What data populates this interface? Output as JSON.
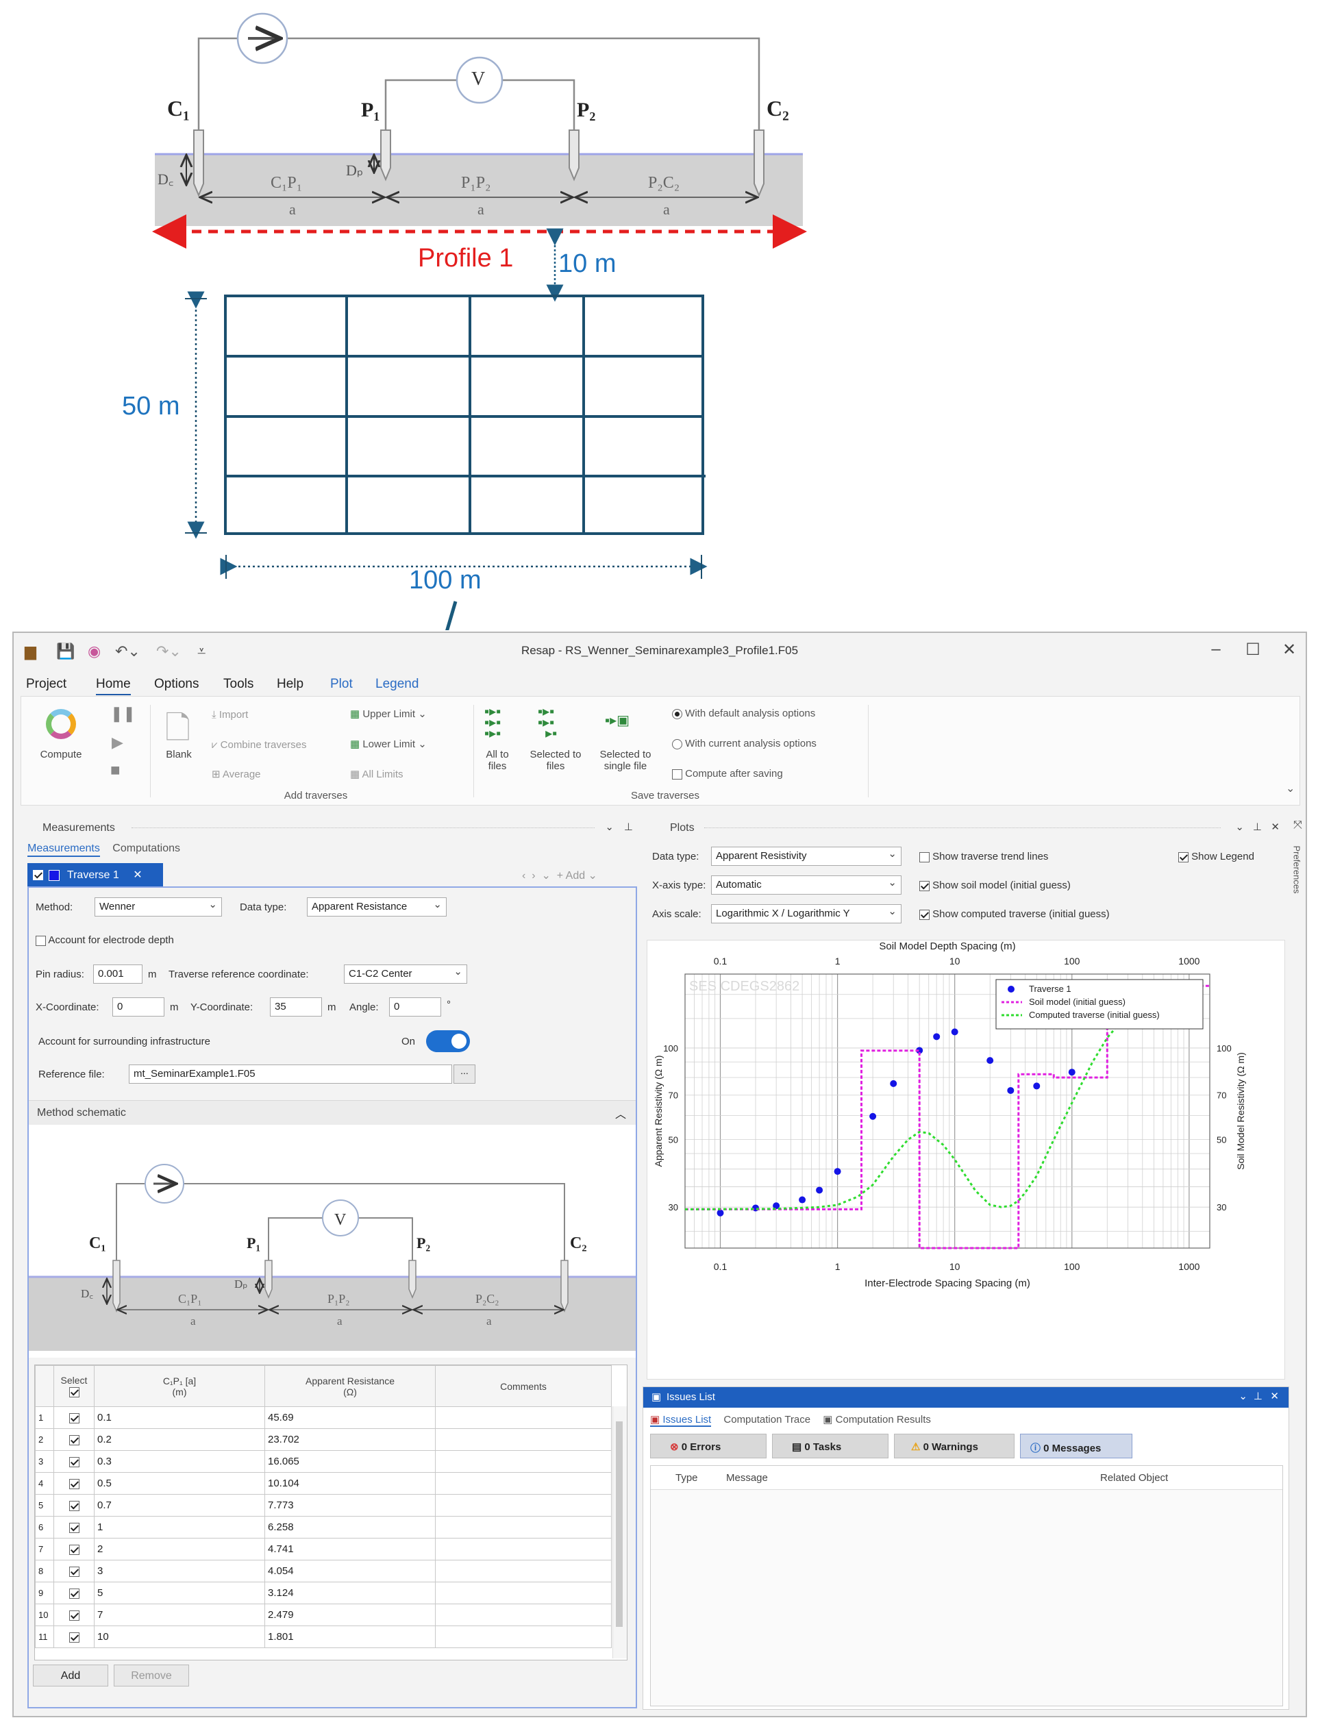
{
  "diagram": {
    "electrodes": {
      "c1": "C₁",
      "p1": "P₁",
      "p2": "P₂",
      "c2": "C₂"
    },
    "depth_c": "D꜀",
    "depth_p": "Dₚ",
    "spacings": [
      "C₁P₁",
      "P₁P₂",
      "P₂C₂"
    ],
    "spacing_unit": "a",
    "voltmeter": "V",
    "profile_label": "Profile 1",
    "offset_label": "10 m",
    "grid_height_label": "50 m",
    "grid_width_label": "100 m"
  },
  "window": {
    "title": "Resap - RS_Wenner_Seminarexample3_Profile1.F05",
    "menu": [
      "Project",
      "Home",
      "Options",
      "Tools",
      "Help",
      "Plot",
      "Legend"
    ]
  },
  "ribbon": {
    "compute": "Compute",
    "blank": "Blank",
    "import": "Import",
    "combine": "Combine traverses",
    "average": "Average",
    "upper": "Upper Limit",
    "lower": "Lower Limit",
    "all_limits": "All Limits",
    "group_add": "Add traverses",
    "all_to_files": "All to files",
    "selected_to_files": "Selected to files",
    "selected_single": "Selected to single file",
    "group_save": "Save traverses",
    "opt_default": "With default analysis options",
    "opt_current": "With current analysis options",
    "opt_compute": "Compute after saving"
  },
  "measurements": {
    "panel_title": "Measurements",
    "tabs": [
      "Measurements",
      "Computations"
    ],
    "traverse_tab": "Traverse 1",
    "add": "Add",
    "method_label": "Method:",
    "method_value": "Wenner",
    "datatype_label": "Data type:",
    "datatype_value": "Apparent Resistance",
    "account_depth": "Account for electrode depth",
    "pin_label": "Pin radius:",
    "pin_value": "0.001",
    "pin_unit": "m",
    "refcoord_label": "Traverse reference coordinate:",
    "refcoord_value": "C1-C2 Center",
    "x_label": "X-Coordinate:",
    "x_value": "0",
    "x_unit": "m",
    "y_label": "Y-Coordinate:",
    "y_value": "35",
    "y_unit": "m",
    "angle_label": "Angle:",
    "angle_value": "0",
    "angle_unit": "°",
    "infra_label": "Account for surrounding infrastructure",
    "infra_state": "On",
    "ref_label": "Reference file:",
    "ref_value": "mt_SeminarExample1.F05",
    "schematic_title": "Method schematic",
    "headers": {
      "select": "Select",
      "spacing": "C₁P₁ [a]",
      "spacing_unit": "(m)",
      "resistance": "Apparent Resistance",
      "resistance_unit": "(Ω)",
      "comments": "Comments"
    },
    "rows": [
      {
        "n": "1",
        "a": "0.1",
        "r": "45.69"
      },
      {
        "n": "2",
        "a": "0.2",
        "r": "23.702"
      },
      {
        "n": "3",
        "a": "0.3",
        "r": "16.065"
      },
      {
        "n": "4",
        "a": "0.5",
        "r": "10.104"
      },
      {
        "n": "5",
        "a": "0.7",
        "r": "7.773"
      },
      {
        "n": "6",
        "a": "1",
        "r": "6.258"
      },
      {
        "n": "7",
        "a": "2",
        "r": "4.741"
      },
      {
        "n": "8",
        "a": "3",
        "r": "4.054"
      },
      {
        "n": "9",
        "a": "5",
        "r": "3.124"
      },
      {
        "n": "10",
        "a": "7",
        "r": "2.479"
      },
      {
        "n": "11",
        "a": "10",
        "r": "1.801"
      }
    ],
    "add_button": "Add",
    "remove_button": "Remove"
  },
  "plots": {
    "panel_title": "Plots",
    "datatype_label": "Data type:",
    "datatype_value": "Apparent Resistivity",
    "xaxis_label": "X-axis type:",
    "xaxis_value": "Automatic",
    "scale_label": "Axis scale:",
    "scale_value": "Logarithmic X / Logarithmic Y",
    "show_trend": "Show traverse trend lines",
    "show_soil": "Show soil model (initial guess)",
    "show_computed": "Show computed traverse (initial guess)",
    "show_legend": "Show Legend",
    "watermark": "SES CDEGS2862",
    "side_tab": "Preferences"
  },
  "issues": {
    "title": "Issues List",
    "tabs": [
      "Issues List",
      "Computation Trace",
      "Computation Results"
    ],
    "errors": "0 Errors",
    "tasks": "0 Tasks",
    "warnings": "0 Warnings",
    "messages": "0 Messages",
    "col_type": "Type",
    "col_message": "Message",
    "col_related": "Related Object"
  },
  "chart_data": {
    "type": "scatter",
    "title": "",
    "top_xlabel": "Soil Model Depth Spacing (m)",
    "xlabel": "Inter-Electrode Spacing Spacing (m)",
    "ylabel": "Apparent Resistivity (Ω m)",
    "y2label": "Soil Model Resistivity (Ω m)",
    "xscale": "log",
    "yscale": "log",
    "xlim": [
      0.05,
      1500
    ],
    "ylim": [
      22,
      175
    ],
    "xticks": [
      "0.1",
      "1",
      "10",
      "100",
      "1000"
    ],
    "yticks": [
      "30",
      "50",
      "70",
      "100"
    ],
    "grid": true,
    "legend_position": "top-right",
    "series": [
      {
        "name": "Traverse 1",
        "kind": "points",
        "color": "#1414e6",
        "x": [
          0.1,
          0.2,
          0.3,
          0.5,
          0.7,
          1,
          2,
          3,
          5,
          7,
          10,
          20,
          30,
          50,
          100,
          200,
          300,
          500,
          700
        ],
        "y": [
          28.7,
          29.8,
          30.3,
          31.7,
          34.1,
          39.3,
          59.6,
          76.4,
          98.2,
          109,
          113,
          91,
          72.5,
          75,
          83.3,
          122,
          160,
          160,
          160
        ]
      },
      {
        "name": "Soil model (initial guess)",
        "kind": "step",
        "color": "#e020e0",
        "x": [
          0.05,
          1.6,
          1.6,
          5,
          5,
          22,
          22,
          35,
          35,
          70,
          70,
          200,
          200,
          1500
        ],
        "y": [
          29.5,
          29.5,
          98,
          98,
          22,
          22,
          22,
          22,
          82,
          82,
          80,
          80,
          160,
          160
        ]
      },
      {
        "name": "Computed traverse (initial guess)",
        "kind": "line",
        "color": "#2fdc2f",
        "x": [
          0.05,
          0.3,
          0.7,
          1,
          1.5,
          2,
          3,
          4,
          5,
          6,
          8,
          10,
          15,
          20,
          25,
          30,
          35,
          40,
          50,
          70,
          100,
          150,
          200,
          300,
          500,
          700,
          1000
        ],
        "y": [
          29.5,
          29.6,
          30,
          30.5,
          32.5,
          35.5,
          44,
          50,
          53,
          52.5,
          48,
          43,
          34,
          30.5,
          30,
          30.3,
          31.5,
          33.5,
          38,
          50,
          66,
          90,
          108,
          130,
          150,
          158,
          162
        ]
      }
    ]
  }
}
